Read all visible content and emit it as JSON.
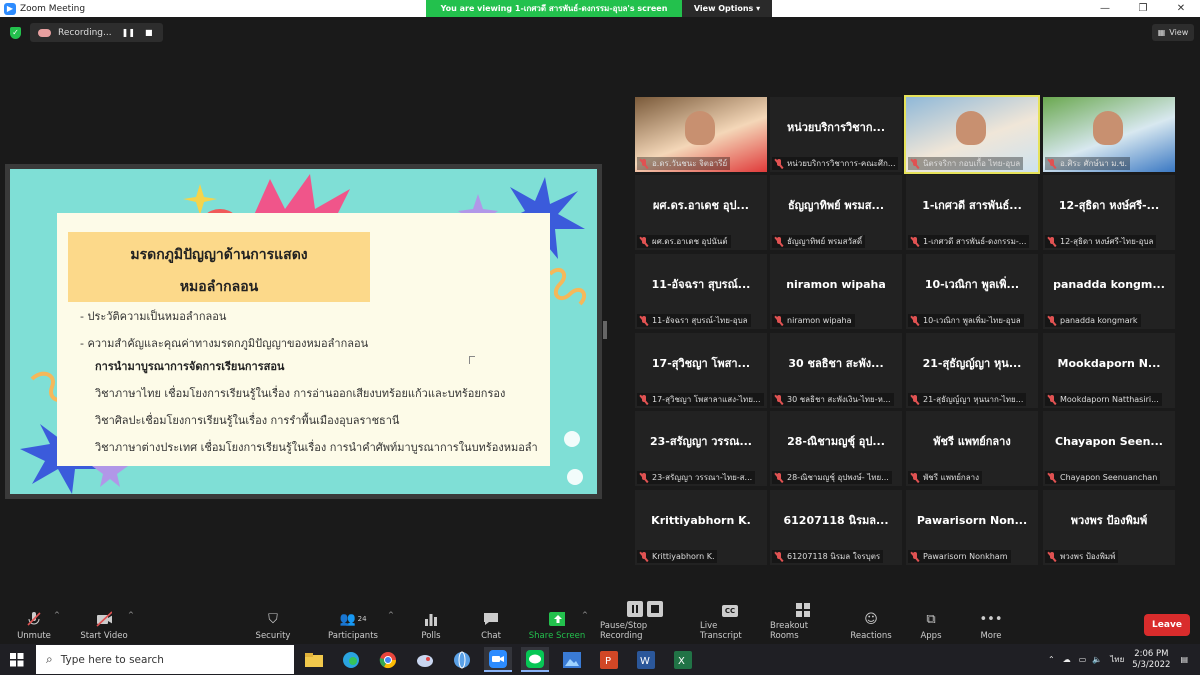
{
  "window": {
    "title": "Zoom Meeting"
  },
  "banner": {
    "viewing": "You are viewing 1-เกศวดี สารพันธ์-ดงกรรม-อุบล's screen",
    "view_options": "View Options"
  },
  "status": {
    "recording": "Recording...",
    "view": "View"
  },
  "slide": {
    "title_line1": "มรดกภูมิปัญญาด้านการแสดง",
    "title_line2": "หมอลำกลอน",
    "bullet1": "- ประวัติความเป็นหมอลำกลอน",
    "bullet2": "- ความสำคัญและคุณค่าทางมรดกภูมิปัญญาของหมอลำกลอน",
    "heading": "การนำมาบูรณาการจัดการเรียนการสอน",
    "line1": "วิชาภาษาไทย เชื่อมโยงการเรียนรู้ในเรื่อง การอ่านออกเสียงบทร้อยแก้วและบทร้อยกรอง",
    "line2": "วิชาศิลปะเชื่อมโยงการเรียนรู้ในเรื่อง การรำพื้นเมืองอุบลราชธานี",
    "line3": "วิชาภาษาต่างประเทศ เชื่อมโยงการเรียนรู้ในเรื่อง การนำคำศัพท์มาบูรณาการในบทร้องหมอลำ"
  },
  "gallery": [
    {
      "name": "",
      "label": "อ.ดร.วันชนะ จิตอารีย์",
      "video": true
    },
    {
      "name": "หน่วยบริการวิชาก...",
      "label": "หน่วยบริการวิชาการ-คณะศึก...",
      "video": false
    },
    {
      "name": "",
      "label": "นิตรจริกา กอบเกื้อ ไทย-อุบล",
      "video": true,
      "active": true
    },
    {
      "name": "",
      "label": "อ.ศิระ ศักษ์นา ม.ข.",
      "video": true
    },
    {
      "name": "ผศ.ดร.อาเดช อุป...",
      "label": "ผศ.ดร.อาเดช อุปนันต์",
      "video": false
    },
    {
      "name": "ธัญญาทิพย์ พรมส...",
      "label": "ธัญญาทิพย์ พรมสวัสดิ์",
      "video": false
    },
    {
      "name": "1-เกศวดี สารพันธ์...",
      "label": "1-เกศวดี สารพันธ์-ดงกรรม-...",
      "video": false
    },
    {
      "name": "12-สุธิดา หงษ์ศรี-...",
      "label": "12-สุธิดา หงษ์ศรี-ไทย-อุบล",
      "video": false
    },
    {
      "name": "11-อัจฉรา สุบรณ์...",
      "label": "11-อัจฉรา สุบรณ์-ไทย-อุบล",
      "video": false
    },
    {
      "name": "niramon wipaha",
      "label": "niramon wipaha",
      "video": false
    },
    {
      "name": "10-เวณิกา พูลเพิ่...",
      "label": "10-เวณิกา พูลเพิ่ม-ไทย-อุบล",
      "video": false
    },
    {
      "name": "panadda kongm...",
      "label": "panadda kongmark",
      "video": false
    },
    {
      "name": "17-สุวิชญา โพสา...",
      "label": "17-สุวิชญา โพสาลาแสง-ไทย...",
      "video": false
    },
    {
      "name": "30 ชลธิชา สะพัง...",
      "label": "30 ชลธิชา สะพังเงิน-ไทย-ห...",
      "video": false
    },
    {
      "name": "21-สุธัญญ์ญา หุน...",
      "label": "21-สุธัญญ์ญา หุนนาก-ไทย...",
      "video": false
    },
    {
      "name": "Mookdaporn N...",
      "label": "Mookdaporn Natthasiri...",
      "video": false
    },
    {
      "name": "23-สรัญญา วรรณ...",
      "label": "23-สรัญญา วรรณา-ไทย-ส...",
      "video": false
    },
    {
      "name": "28-ณิชามญชุ์ อุป...",
      "label": "28-ณิชามญชุ์ อุปพงษ์- ไทย...",
      "video": false
    },
    {
      "name": "พัชรี แพทย์กลาง",
      "label": "พัชรี แพทย์กลาง",
      "video": false
    },
    {
      "name": "Chayapon Seen...",
      "label": "Chayapon Seenuanchan",
      "video": false
    },
    {
      "name": "Krittiyabhorn K.",
      "label": "Krittiyabhorn K.",
      "video": false
    },
    {
      "name": "61207118 นิรมล...",
      "label": "61207118 นิรมล ใจรบุตร",
      "video": false
    },
    {
      "name": "Pawarisorn Non...",
      "label": "Pawarisorn Nonkham",
      "video": false
    },
    {
      "name": "พวงพร ป้องพิมพ์",
      "label": "พวงพร ป้องพิมพ์",
      "video": false
    }
  ],
  "toolbar": {
    "unmute": "Unmute",
    "start_video": "Start Video",
    "security": "Security",
    "participants": "Participants",
    "participants_count": "24",
    "polls": "Polls",
    "chat": "Chat",
    "share_screen": "Share Screen",
    "pause_recording": "Pause/Stop Recording",
    "live_transcript": "Live Transcript",
    "breakout_rooms": "Breakout Rooms",
    "reactions": "Reactions",
    "apps": "Apps",
    "more": "More",
    "leave": "Leave",
    "cc": "CC"
  },
  "taskbar": {
    "search_placeholder": "Type here to search",
    "time": "2:06 PM",
    "date": "5/3/2022",
    "lang": "ไทย"
  },
  "colors": {
    "accent_green": "#23c14d",
    "leave_red": "#d92c2c",
    "slide_bg": "#7fdfd6",
    "title_box": "#fcd98a",
    "active_border": "#e6e25a"
  }
}
